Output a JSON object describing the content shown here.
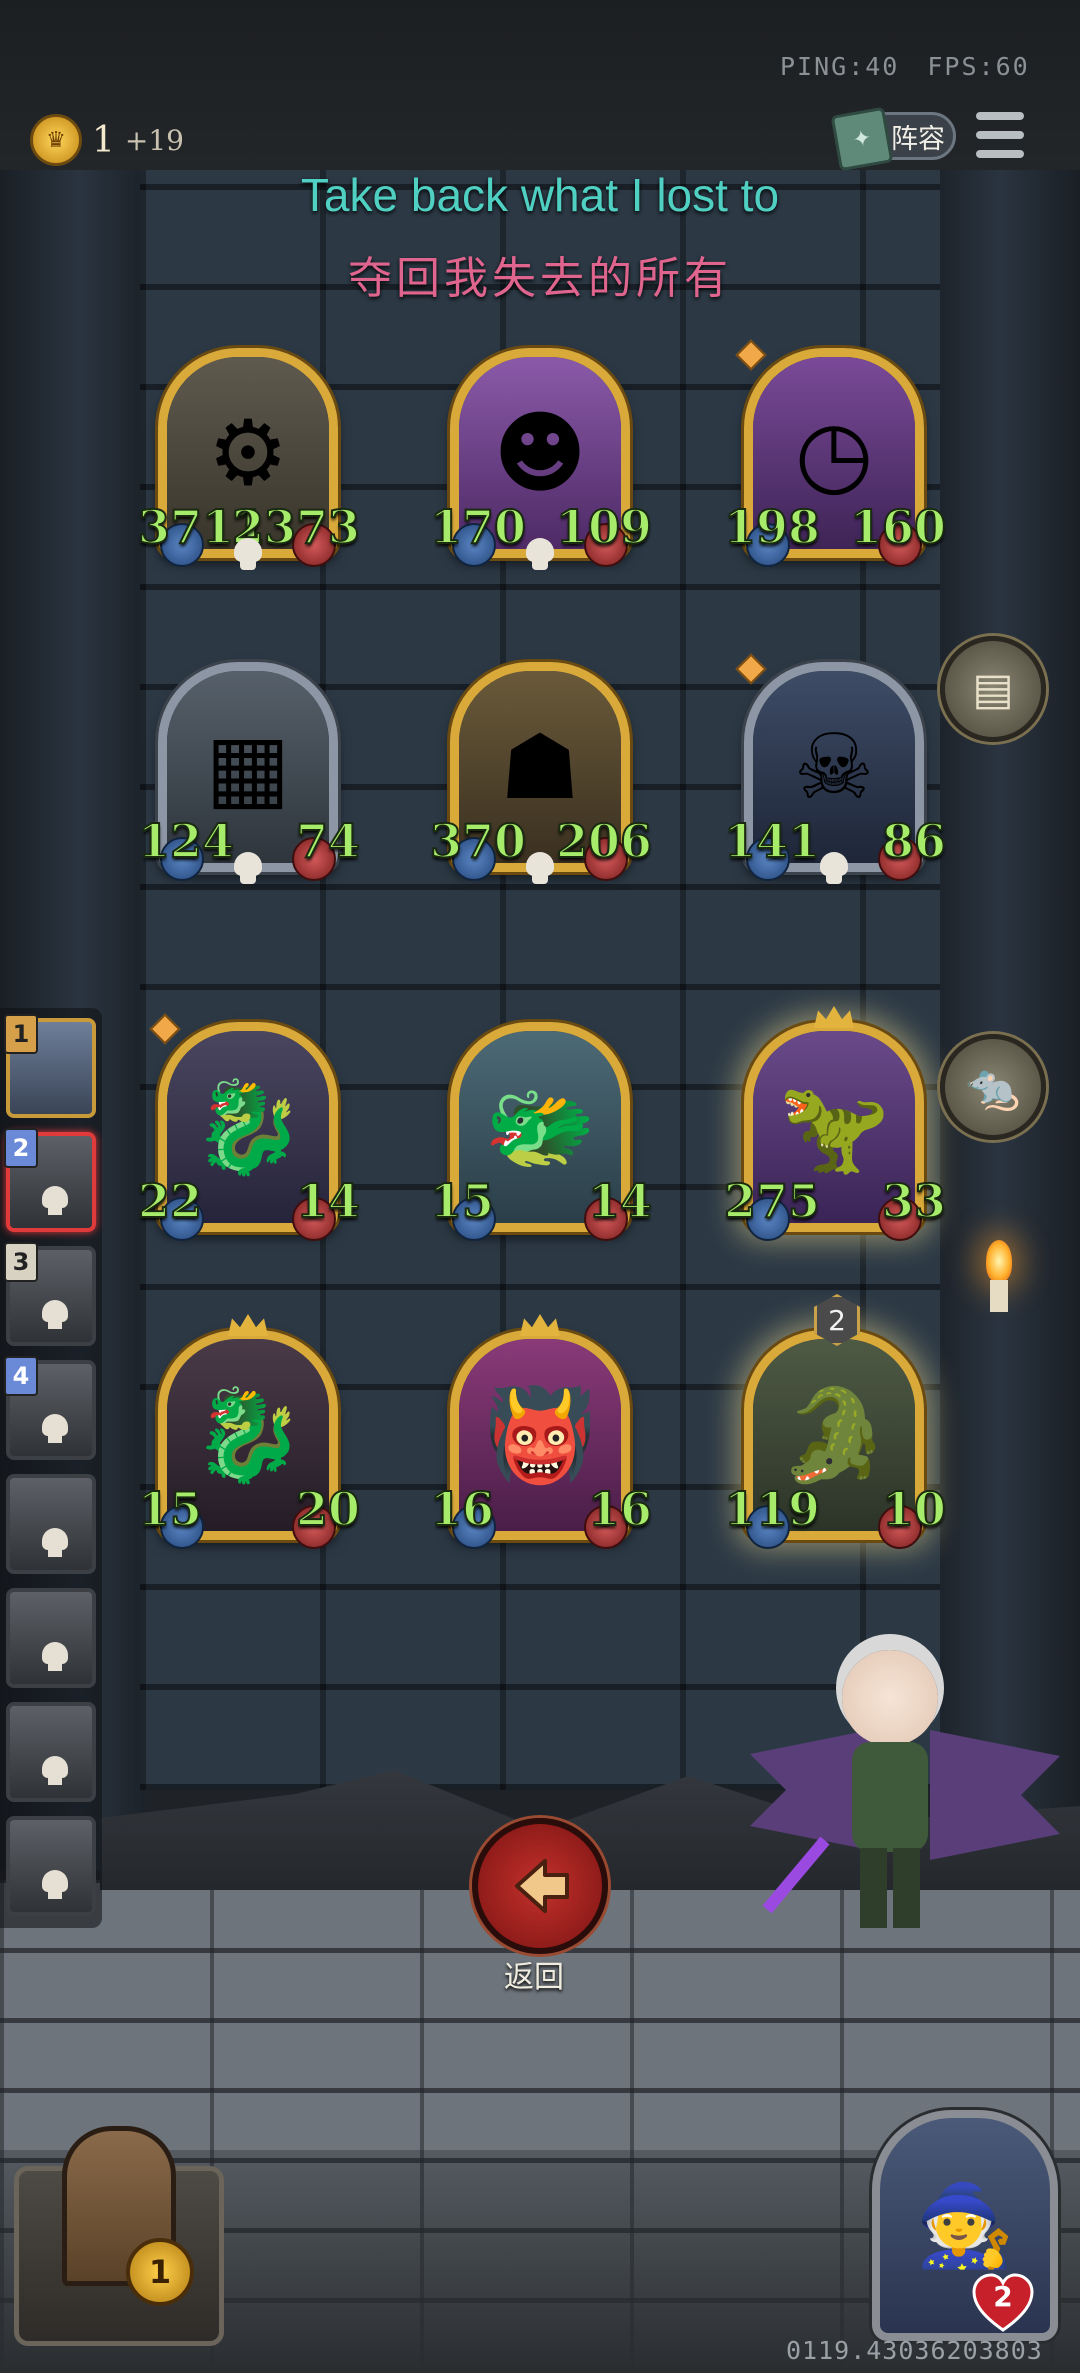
{
  "hud": {
    "ping": "PING:40",
    "fps": "FPS:60",
    "gold_value": "1",
    "gold_increment": "+19",
    "lineup_label": "阵容"
  },
  "title": {
    "english": "Take back what I lost to",
    "chinese": "夺回我失去的所有"
  },
  "cards": [
    {
      "atk": "3711",
      "hp": "2373"
    },
    {
      "atk": "170",
      "hp": "109"
    },
    {
      "atk": "198",
      "hp": "160"
    },
    {
      "atk": "124",
      "hp": "74"
    },
    {
      "atk": "370",
      "hp": "206"
    },
    {
      "atk": "141",
      "hp": "86"
    },
    {
      "atk": "22",
      "hp": "14"
    },
    {
      "atk": "15",
      "hp": "14"
    },
    {
      "atk": "275",
      "hp": "33"
    },
    {
      "atk": "15",
      "hp": "20"
    },
    {
      "atk": "16",
      "hp": "16"
    },
    {
      "atk": "119",
      "hp": "10",
      "tier": "2"
    }
  ],
  "hand": {
    "slot_numbers": [
      "1",
      "2",
      "3",
      "4"
    ]
  },
  "back_button": {
    "label": "返回"
  },
  "deck": {
    "count": "1"
  },
  "hero_portrait": {
    "health": "2"
  },
  "build_id": "0119.43036203803",
  "colors": {
    "stat_green": "#a6ec6a",
    "title_teal": "#4fd0c2",
    "title_pink": "#e0658e",
    "frame_gold": "#d9a93a",
    "back_red": "#c4302c"
  }
}
